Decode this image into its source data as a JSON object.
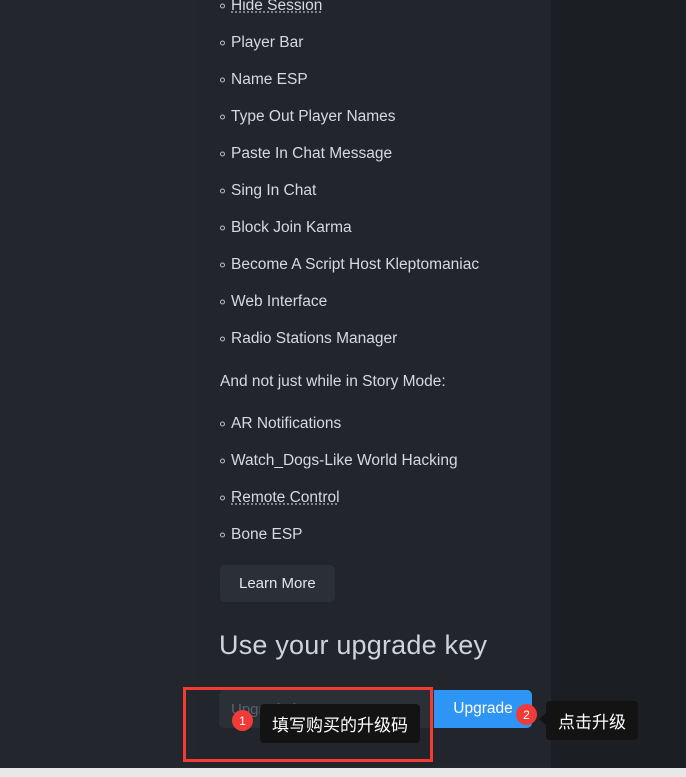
{
  "theme": {
    "page_bg": "#23272d",
    "card_bg": "#22262c",
    "outer_bg": "#1b1f24",
    "text": "#d6dade",
    "accent_blue": "#2f95f5",
    "annotation_red": "#f43a31",
    "badge_red": "#f03b38",
    "tooltip_bg": "#131313"
  },
  "features": {
    "story_mode_items": [
      {
        "label": "Hide Session",
        "dotted": true
      },
      {
        "label": "Player Bar",
        "dotted": false
      },
      {
        "label": "Name ESP",
        "dotted": false
      },
      {
        "label": "Type Out Player Names",
        "dotted": false
      },
      {
        "label": "Paste In Chat Message",
        "dotted": false
      },
      {
        "label": "Sing In Chat",
        "dotted": false
      },
      {
        "label": "Block Join Karma",
        "dotted": false
      },
      {
        "label": "Become A Script Host Kleptomaniac",
        "dotted": false
      },
      {
        "label": "Web Interface",
        "dotted": false
      },
      {
        "label": "Radio Stations Manager",
        "dotted": false
      }
    ],
    "section_note": "And not just while in Story Mode:",
    "other_items": [
      {
        "label": "AR Notifications",
        "dotted": false
      },
      {
        "label": "Watch_Dogs-Like World Hacking",
        "dotted": false
      },
      {
        "label": "Remote Control",
        "dotted": true
      },
      {
        "label": "Bone ESP",
        "dotted": false
      }
    ],
    "learn_more_label": "Learn More"
  },
  "upgrade": {
    "heading": "Use your upgrade key",
    "input_placeholder": "Upgrade key",
    "input_value": "",
    "button_label": "Upgrade"
  },
  "annotations": {
    "step1": {
      "badge": "1",
      "tooltip": "填写购买的升级码"
    },
    "step2": {
      "badge": "2",
      "tooltip": "点击升级"
    }
  }
}
